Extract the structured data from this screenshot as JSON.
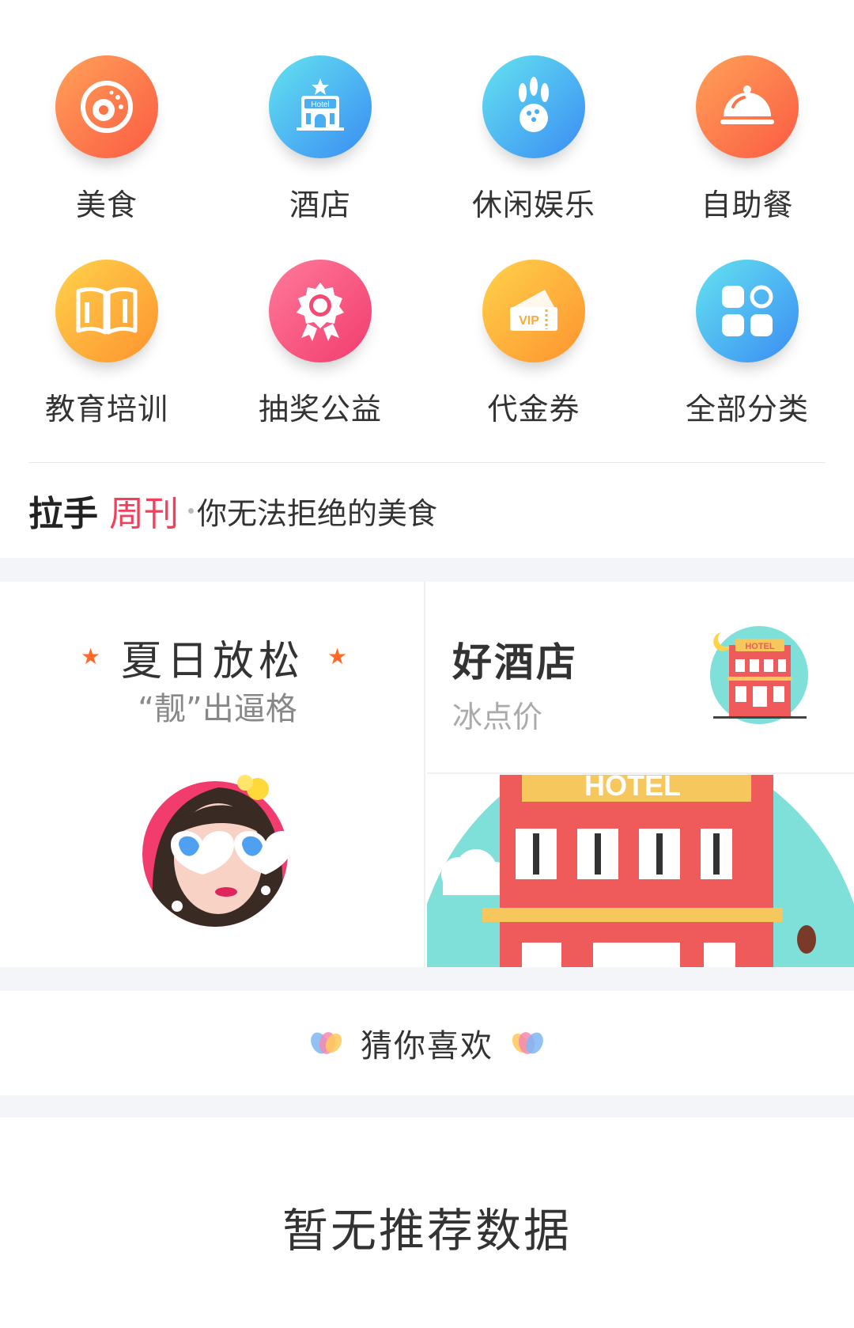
{
  "categories": [
    {
      "label": "美食",
      "icon": "donut-icon",
      "color": "#fb6a45"
    },
    {
      "label": "酒店",
      "icon": "hotel-icon",
      "color": "#4aaef2"
    },
    {
      "label": "休闲娱乐",
      "icon": "bowling-icon",
      "color": "#4aaef2"
    },
    {
      "label": "自助餐",
      "icon": "food-cloche-icon",
      "color": "#fb6a45"
    },
    {
      "label": "教育培训",
      "icon": "book-icon",
      "color": "#fdaa3a"
    },
    {
      "label": "抽奖公益",
      "icon": "award-ribbon-icon",
      "color": "#f24a74"
    },
    {
      "label": "代金券",
      "icon": "vip-ticket-icon",
      "color": "#fdaa3a"
    },
    {
      "label": "全部分类",
      "icon": "grid-apps-icon",
      "color": "#4aaef2"
    }
  ],
  "weekly": {
    "brand_bold": "拉手",
    "brand_accent": "周刊",
    "subtitle": "你无法拒绝的美食"
  },
  "promo_left": {
    "title": "夏日放松",
    "subtitle": "“靓”出逼格"
  },
  "promo_right": {
    "title": "好酒店",
    "subtitle": "冰点价",
    "sign_text": "HOTEL"
  },
  "guess_section": {
    "title": "猜你喜欢"
  },
  "empty_state": {
    "message": "暂无推荐数据"
  },
  "colors": {
    "accent_red": "#f0405c",
    "section_gap": "#f4f5f8"
  }
}
